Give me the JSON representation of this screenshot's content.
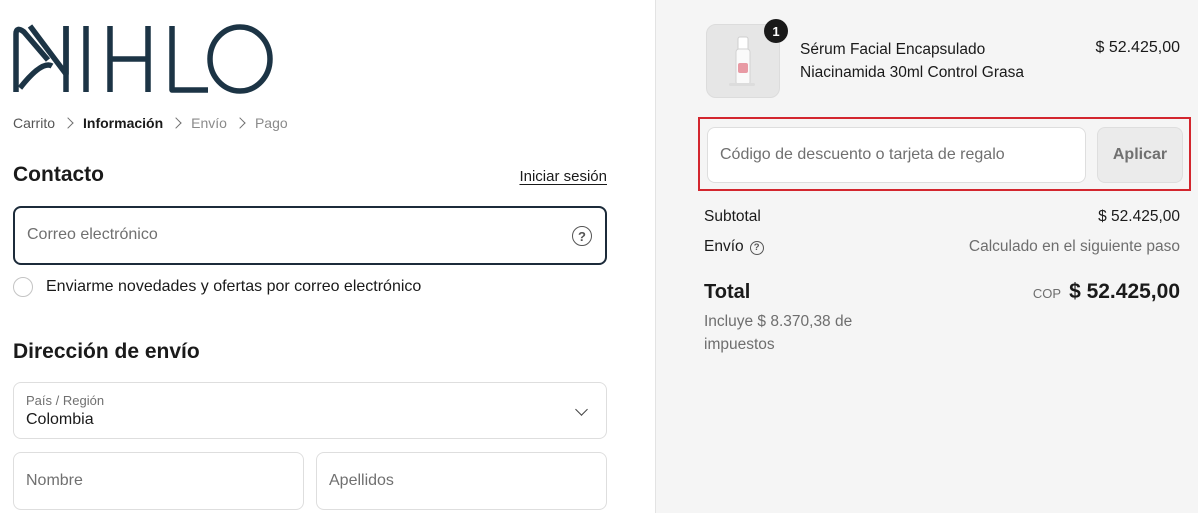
{
  "brand": {
    "logo_text": "NIHLO",
    "color": "#1c3445"
  },
  "breadcrumb": [
    {
      "label": "Carrito",
      "state": "link"
    },
    {
      "label": "Información",
      "state": "active"
    },
    {
      "label": "Envío",
      "state": "dim"
    },
    {
      "label": "Pago",
      "state": "dim"
    }
  ],
  "contact": {
    "title": "Contacto",
    "login_link": "Iniciar sesión",
    "email_placeholder": "Correo electrónico",
    "newsletter_label": "Enviarme novedades y ofertas por correo electrónico"
  },
  "shipping": {
    "title": "Dirección de envío",
    "country_label": "País / Región",
    "country_value": "Colombia",
    "first_name_placeholder": "Nombre",
    "last_name_placeholder": "Apellidos"
  },
  "cart": {
    "item": {
      "quantity": "1",
      "name": "Sérum Facial Encapsulado Niacinamida 30ml Control Grasa",
      "price": "$ 52.425,00"
    },
    "discount_placeholder": "Código de descuento o tarjeta de regalo",
    "apply_label": "Aplicar",
    "subtotal_label": "Subtotal",
    "subtotal_value": "$ 52.425,00",
    "shipping_label": "Envío",
    "shipping_value": "Calculado en el siguiente paso",
    "total_label": "Total",
    "currency": "COP",
    "total_value": "$ 52.425,00",
    "tax_note": "Incluye $ 8.370,38 de impuestos"
  },
  "colors": {
    "highlight_border": "#d3262e",
    "focus_border": "#1c2b3a",
    "summary_bg": "#f5f5f5"
  }
}
